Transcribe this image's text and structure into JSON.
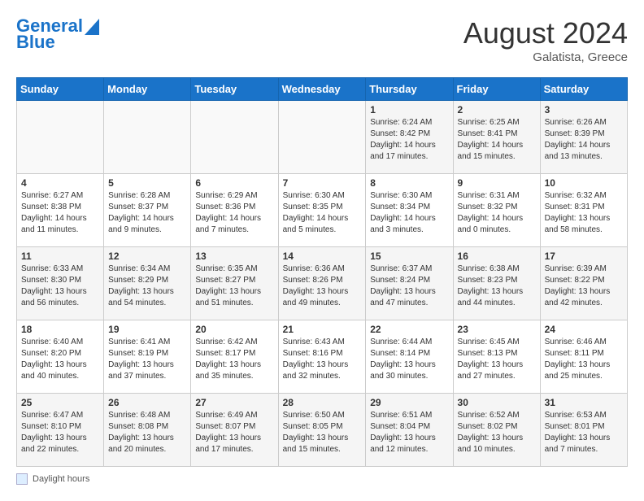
{
  "logo": {
    "line1": "General",
    "line2": "Blue"
  },
  "title": "August 2024",
  "subtitle": "Galatista, Greece",
  "days_of_week": [
    "Sunday",
    "Monday",
    "Tuesday",
    "Wednesday",
    "Thursday",
    "Friday",
    "Saturday"
  ],
  "weeks": [
    [
      {
        "num": "",
        "detail": ""
      },
      {
        "num": "",
        "detail": ""
      },
      {
        "num": "",
        "detail": ""
      },
      {
        "num": "",
        "detail": ""
      },
      {
        "num": "1",
        "detail": "Sunrise: 6:24 AM\nSunset: 8:42 PM\nDaylight: 14 hours and 17 minutes."
      },
      {
        "num": "2",
        "detail": "Sunrise: 6:25 AM\nSunset: 8:41 PM\nDaylight: 14 hours and 15 minutes."
      },
      {
        "num": "3",
        "detail": "Sunrise: 6:26 AM\nSunset: 8:39 PM\nDaylight: 14 hours and 13 minutes."
      }
    ],
    [
      {
        "num": "4",
        "detail": "Sunrise: 6:27 AM\nSunset: 8:38 PM\nDaylight: 14 hours and 11 minutes."
      },
      {
        "num": "5",
        "detail": "Sunrise: 6:28 AM\nSunset: 8:37 PM\nDaylight: 14 hours and 9 minutes."
      },
      {
        "num": "6",
        "detail": "Sunrise: 6:29 AM\nSunset: 8:36 PM\nDaylight: 14 hours and 7 minutes."
      },
      {
        "num": "7",
        "detail": "Sunrise: 6:30 AM\nSunset: 8:35 PM\nDaylight: 14 hours and 5 minutes."
      },
      {
        "num": "8",
        "detail": "Sunrise: 6:30 AM\nSunset: 8:34 PM\nDaylight: 14 hours and 3 minutes."
      },
      {
        "num": "9",
        "detail": "Sunrise: 6:31 AM\nSunset: 8:32 PM\nDaylight: 14 hours and 0 minutes."
      },
      {
        "num": "10",
        "detail": "Sunrise: 6:32 AM\nSunset: 8:31 PM\nDaylight: 13 hours and 58 minutes."
      }
    ],
    [
      {
        "num": "11",
        "detail": "Sunrise: 6:33 AM\nSunset: 8:30 PM\nDaylight: 13 hours and 56 minutes."
      },
      {
        "num": "12",
        "detail": "Sunrise: 6:34 AM\nSunset: 8:29 PM\nDaylight: 13 hours and 54 minutes."
      },
      {
        "num": "13",
        "detail": "Sunrise: 6:35 AM\nSunset: 8:27 PM\nDaylight: 13 hours and 51 minutes."
      },
      {
        "num": "14",
        "detail": "Sunrise: 6:36 AM\nSunset: 8:26 PM\nDaylight: 13 hours and 49 minutes."
      },
      {
        "num": "15",
        "detail": "Sunrise: 6:37 AM\nSunset: 8:24 PM\nDaylight: 13 hours and 47 minutes."
      },
      {
        "num": "16",
        "detail": "Sunrise: 6:38 AM\nSunset: 8:23 PM\nDaylight: 13 hours and 44 minutes."
      },
      {
        "num": "17",
        "detail": "Sunrise: 6:39 AM\nSunset: 8:22 PM\nDaylight: 13 hours and 42 minutes."
      }
    ],
    [
      {
        "num": "18",
        "detail": "Sunrise: 6:40 AM\nSunset: 8:20 PM\nDaylight: 13 hours and 40 minutes."
      },
      {
        "num": "19",
        "detail": "Sunrise: 6:41 AM\nSunset: 8:19 PM\nDaylight: 13 hours and 37 minutes."
      },
      {
        "num": "20",
        "detail": "Sunrise: 6:42 AM\nSunset: 8:17 PM\nDaylight: 13 hours and 35 minutes."
      },
      {
        "num": "21",
        "detail": "Sunrise: 6:43 AM\nSunset: 8:16 PM\nDaylight: 13 hours and 32 minutes."
      },
      {
        "num": "22",
        "detail": "Sunrise: 6:44 AM\nSunset: 8:14 PM\nDaylight: 13 hours and 30 minutes."
      },
      {
        "num": "23",
        "detail": "Sunrise: 6:45 AM\nSunset: 8:13 PM\nDaylight: 13 hours and 27 minutes."
      },
      {
        "num": "24",
        "detail": "Sunrise: 6:46 AM\nSunset: 8:11 PM\nDaylight: 13 hours and 25 minutes."
      }
    ],
    [
      {
        "num": "25",
        "detail": "Sunrise: 6:47 AM\nSunset: 8:10 PM\nDaylight: 13 hours and 22 minutes."
      },
      {
        "num": "26",
        "detail": "Sunrise: 6:48 AM\nSunset: 8:08 PM\nDaylight: 13 hours and 20 minutes."
      },
      {
        "num": "27",
        "detail": "Sunrise: 6:49 AM\nSunset: 8:07 PM\nDaylight: 13 hours and 17 minutes."
      },
      {
        "num": "28",
        "detail": "Sunrise: 6:50 AM\nSunset: 8:05 PM\nDaylight: 13 hours and 15 minutes."
      },
      {
        "num": "29",
        "detail": "Sunrise: 6:51 AM\nSunset: 8:04 PM\nDaylight: 13 hours and 12 minutes."
      },
      {
        "num": "30",
        "detail": "Sunrise: 6:52 AM\nSunset: 8:02 PM\nDaylight: 13 hours and 10 minutes."
      },
      {
        "num": "31",
        "detail": "Sunrise: 6:53 AM\nSunset: 8:01 PM\nDaylight: 13 hours and 7 minutes."
      }
    ]
  ],
  "footer": {
    "label": "Daylight hours"
  }
}
